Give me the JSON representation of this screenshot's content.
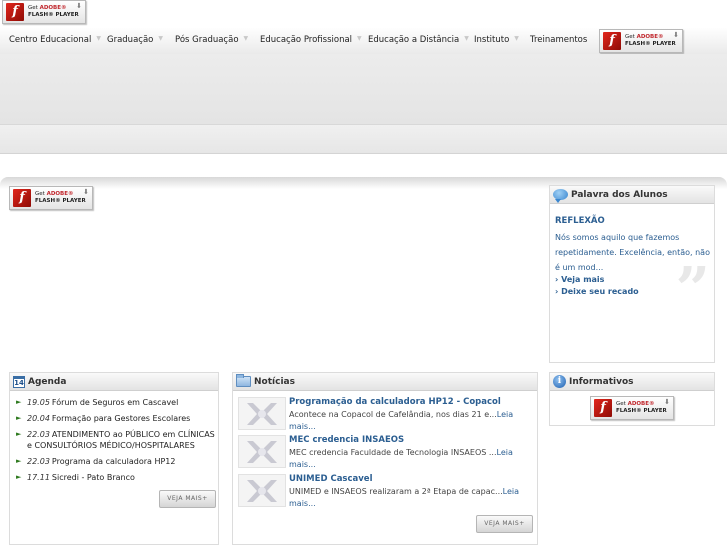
{
  "flash_badge": {
    "get": "Get",
    "adobe": "ADOBE®",
    "player": "FLASH® PLAYER",
    "logo_letter": "f"
  },
  "nav": {
    "items": [
      {
        "label": "Centro Educacional"
      },
      {
        "label": "Graduação"
      },
      {
        "label": "Pós Graduação"
      },
      {
        "label": "Educação Profissional"
      },
      {
        "label": "Educação a Distância"
      },
      {
        "label": "Instituto"
      },
      {
        "label": "Treinamentos"
      }
    ]
  },
  "agenda": {
    "title": "Agenda",
    "icon_number": "14",
    "items": [
      {
        "date": "19.05",
        "text": "Fórum de Seguros em Cascavel"
      },
      {
        "date": "20.04",
        "text": "Formação para Gestores Escolares"
      },
      {
        "date": "22.03",
        "text": "ATENDIMENTO ao PÚBLICO em CLÍNICAS e CONSULTÓRIOS MÉDICO/HOSPITALARES"
      },
      {
        "date": "22.03",
        "text": "Programa da calculadora HP12"
      },
      {
        "date": "17.11",
        "text": "Sicredi - Pato Branco"
      }
    ],
    "more_label": "VEJA MAIS+"
  },
  "noticias": {
    "title": "Notícias",
    "items": [
      {
        "title": "Programação da calculadora HP12 - Copacol",
        "text": "Acontece na Copacol de Cafelândia, nos dias 21 e...",
        "more": "Leia mais..."
      },
      {
        "title": "MEC credencia INSAEOS",
        "text": "MEC credencia Faculdade de Tecnologia INSAEOS ...",
        "more": "Leia mais..."
      },
      {
        "title": "UNIMED Cascavel",
        "text": "UNIMED e INSAEOS realizaram  a 2ª Etapa de capac...",
        "more": "Leia mais..."
      }
    ],
    "more_label": "VEJA MAIS+"
  },
  "palavra": {
    "title": "Palavra dos Alunos",
    "post_title": "REFLEXÃO",
    "post_text": "Nós somos aquilo que fazemos repetidamente. Excelência, então, não é um mod...",
    "links": [
      "› Veja mais",
      "› Deixe seu recado"
    ],
    "quote_glyph": "”"
  },
  "informativos": {
    "title": "Informativos"
  },
  "icons": {
    "agenda": "calendar-icon",
    "noticias": "folder-icon",
    "palavra": "speech-bubble-icon",
    "informativos": "info-icon",
    "bullet": "triangle-bullet-icon",
    "thumb": "insaeos-logo-icon"
  },
  "colors": {
    "link_blue": "#2b5e91",
    "bullet_green": "#2f7a1f",
    "flash_red": "#c1272d"
  }
}
